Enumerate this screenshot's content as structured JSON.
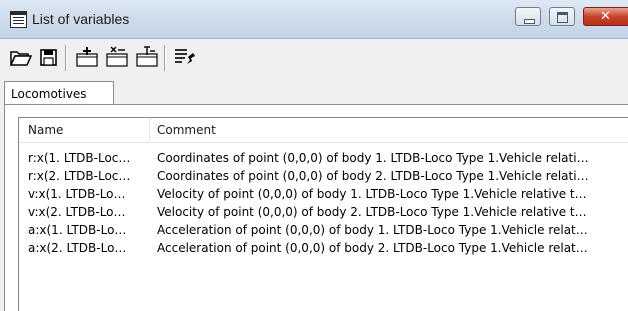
{
  "window": {
    "title": "List of variables",
    "controls": {
      "minimize": "minimize",
      "maximize": "maximize",
      "close": "close"
    }
  },
  "toolbar": {
    "buttons": [
      {
        "name": "open-folder-icon"
      },
      {
        "name": "save-icon"
      },
      {
        "name": "add-variable-icon"
      },
      {
        "name": "remove-variable-icon"
      },
      {
        "name": "edit-variable-icon"
      },
      {
        "name": "pin-list-icon"
      }
    ]
  },
  "tabs": [
    {
      "label": "Locomotives",
      "active": true
    }
  ],
  "table": {
    "columns": [
      "Name",
      "Comment"
    ],
    "rows": [
      {
        "name": "r:x(1. LTDB-Loc…",
        "comment": "Coordinates of point (0,0,0) of body 1. LTDB-Loco Type 1.Vehicle relati…"
      },
      {
        "name": "r:x(2. LTDB-Loc…",
        "comment": "Coordinates of point (0,0,0) of body 2. LTDB-Loco Type 1.Vehicle relati…"
      },
      {
        "name": "v:x(1. LTDB-Lo…",
        "comment": "Velocity of point (0,0,0) of body 1. LTDB-Loco Type 1.Vehicle relative t…"
      },
      {
        "name": "v:x(2. LTDB-Lo…",
        "comment": "Velocity of point (0,0,0) of body 2. LTDB-Loco Type 1.Vehicle relative t…"
      },
      {
        "name": "a:x(1. LTDB-Lo…",
        "comment": "Acceleration of point (0,0,0) of body 1. LTDB-Loco Type 1.Vehicle relat…"
      },
      {
        "name": "a:x(2. LTDB-Lo…",
        "comment": "Acceleration of point (0,0,0) of body 2. LTDB-Loco Type 1.Vehicle relat…"
      }
    ]
  }
}
